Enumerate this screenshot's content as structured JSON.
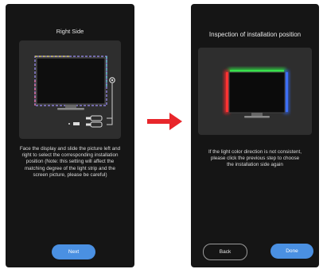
{
  "left_screen": {
    "title": "Right Side",
    "description": "Face the display and slide the picture left and right to select the corresponding installation position (Note: this setting will affect the matching degree of the light strip and the screen picture, please be careful)",
    "next_label": "Next"
  },
  "right_screen": {
    "title": "Inspection of installation position",
    "description": "If the light color direction is not consistent, please click the previous step to choose the installation side again",
    "back_label": "Back",
    "done_label": "Done"
  },
  "colors": {
    "phone_bg": "#151515",
    "panel_bg": "#2e2e2e",
    "accent_blue": "#4a90e2",
    "arrow_red": "#e8262b",
    "light_green": "#2ecc40",
    "light_red": "#e6262b",
    "light_blue": "#2f5fe0"
  }
}
